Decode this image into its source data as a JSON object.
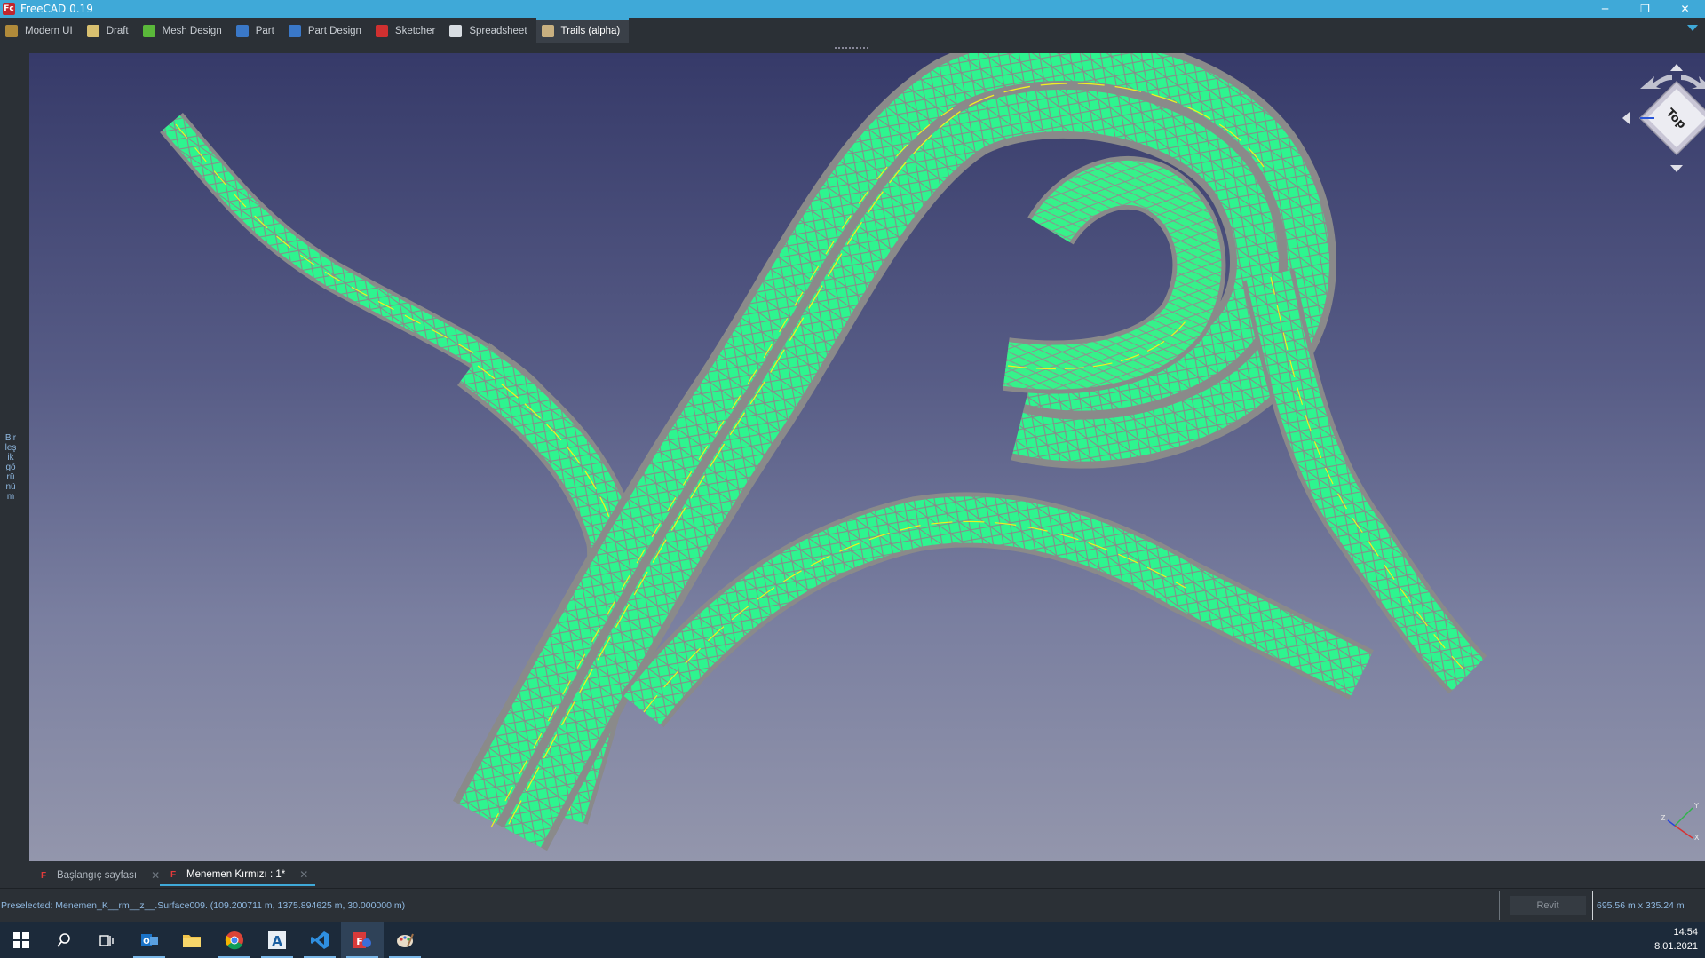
{
  "window": {
    "title": "FreeCAD 0.19",
    "app_icon_glyph": "Fc",
    "controls": {
      "minimize": "─",
      "restore": "❐",
      "close": "✕"
    }
  },
  "workbench_tabs": [
    {
      "label": "Modern UI",
      "icon": "modern-ui-icon",
      "color": "#b08a3a",
      "active": false
    },
    {
      "label": "Draft",
      "icon": "draft-icon",
      "color": "#d8c070",
      "active": false
    },
    {
      "label": "Mesh Design",
      "icon": "mesh-design-icon",
      "color": "#5ab83a",
      "active": false
    },
    {
      "label": "Part",
      "icon": "part-icon",
      "color": "#3a78c8",
      "active": false
    },
    {
      "label": "Part Design",
      "icon": "part-design-icon",
      "color": "#3a78c8",
      "active": false
    },
    {
      "label": "Sketcher",
      "icon": "sketcher-icon",
      "color": "#d03030",
      "active": false
    },
    {
      "label": "Spreadsheet",
      "icon": "spreadsheet-icon",
      "color": "#d8dde2",
      "active": false
    },
    {
      "label": "Trails (alpha)",
      "icon": "trails-icon",
      "color": "#c8b080",
      "active": true
    }
  ],
  "left_dock": {
    "label": "Birleşik görünüm"
  },
  "viewport": {
    "background_top": "#363a69",
    "background_bottom": "#9396ac",
    "mesh_fill": "#2ef58f",
    "mesh_edge": "#8a8a8a",
    "highlight_line": "#f0f020",
    "navcube_face": "Top",
    "axis_labels": {
      "x": "X",
      "y": "Y",
      "z": "Z"
    }
  },
  "document_tabs": [
    {
      "label": "Başlangıç sayfası",
      "active": false
    },
    {
      "label": "Menemen Kırmızı : 1*",
      "active": true
    }
  ],
  "status": {
    "preselected": "Preselected: Menemen_K__rm__z__.Surface009. (109.200711 m, 1375.894625 m, 30.000000 m)",
    "navigation_style": "Revit",
    "dimensions": "695.56 m x 335.24 m"
  },
  "taskbar": {
    "apps": [
      {
        "name": "windows-start",
        "active": false,
        "running": false
      },
      {
        "name": "search",
        "active": false,
        "running": false
      },
      {
        "name": "task-view",
        "active": false,
        "running": false
      },
      {
        "name": "outlook",
        "active": false,
        "running": true
      },
      {
        "name": "file-explorer",
        "active": false,
        "running": false
      },
      {
        "name": "chrome",
        "active": false,
        "running": true
      },
      {
        "name": "autocad",
        "active": false,
        "running": true
      },
      {
        "name": "vscode",
        "active": false,
        "running": true
      },
      {
        "name": "freecad",
        "active": true,
        "running": true
      },
      {
        "name": "paint",
        "active": false,
        "running": true
      }
    ],
    "time": "14:54",
    "date": "8.01.2021"
  }
}
